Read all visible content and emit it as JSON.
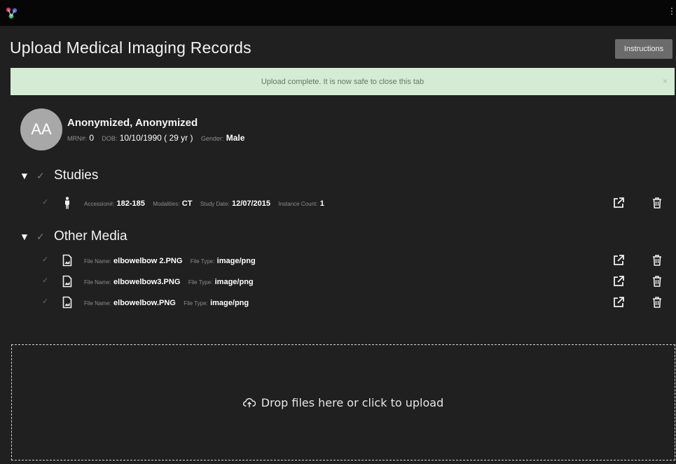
{
  "header": {
    "logo_icon": "app-logo-icon",
    "title": "Upload Medical Imaging Records",
    "instructions_label": "Instructions"
  },
  "alert": {
    "message": "Upload complete. It is now safe to close this tab",
    "close_label": "×",
    "background": "#d5ebd4"
  },
  "patient": {
    "initials": "AA",
    "name": "Anonymized, Anonymized",
    "mrn_label": "MRN#:",
    "mrn": "0",
    "dob_label": "DOB:",
    "dob": "10/10/1990 ( 29 yr )",
    "gender_label": "Gender:",
    "gender": "Male"
  },
  "studies": {
    "caret": "▼",
    "check": "✓",
    "title": "Studies",
    "items": [
      {
        "check": "✓",
        "icon": "person-icon",
        "accession_label": "Accession#:",
        "accession": "182-185",
        "modalities_label": "Modalities:",
        "modalities": "CT",
        "study_date_label": "Study Date:",
        "study_date": "12/07/2015",
        "instance_count_label": "Instance Count:",
        "instance_count": "1"
      }
    ]
  },
  "other_media": {
    "caret": "▼",
    "check": "✓",
    "title": "Other Media",
    "items": [
      {
        "check": "✓",
        "icon": "image-file-icon",
        "file_name_label": "File Name:",
        "file_name": "elbowelbow 2.PNG",
        "file_type_label": "File Type:",
        "file_type": "image/png"
      },
      {
        "check": "✓",
        "icon": "image-file-icon",
        "file_name_label": "File Name:",
        "file_name": "elbowelbow3.PNG",
        "file_type_label": "File Type:",
        "file_type": "image/png"
      },
      {
        "check": "✓",
        "icon": "image-file-icon",
        "file_name_label": "File Name:",
        "file_name": "elbowelbow.PNG",
        "file_type_label": "File Type:",
        "file_type": "image/png"
      }
    ]
  },
  "row_actions": {
    "open_icon": "external-link-icon",
    "delete_icon": "trash-icon"
  },
  "dropzone": {
    "icon": "cloud-upload-icon",
    "label": "Drop files here or click to upload"
  }
}
